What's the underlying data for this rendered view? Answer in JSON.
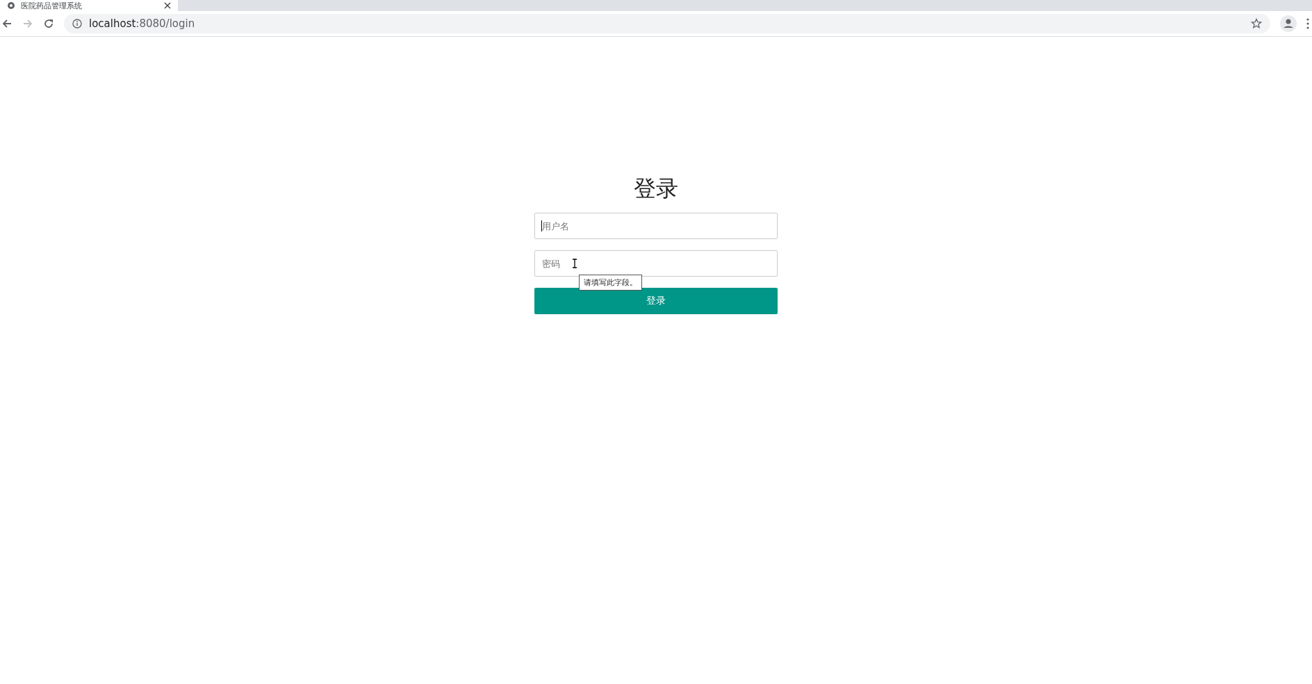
{
  "browser": {
    "tab_title": "医院药品管理系统",
    "url_host": "localhost",
    "url_path": ":8080/login"
  },
  "login": {
    "title": "登录",
    "username": {
      "placeholder": "用户名"
    },
    "password": {
      "placeholder": "密码"
    },
    "tooltip": "请填写此字段。",
    "submit": "登录"
  }
}
